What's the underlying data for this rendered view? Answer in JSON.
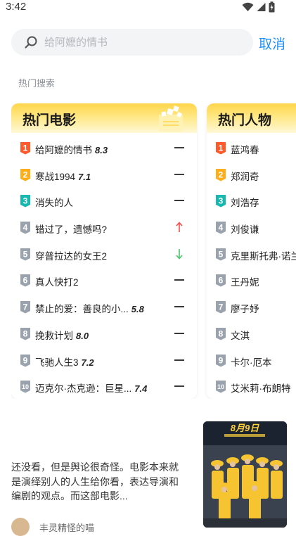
{
  "status": {
    "time": "3:42"
  },
  "search": {
    "placeholder": "给阿嬷的情书",
    "cancel_label": "取消"
  },
  "hot_search_label": "热门搜索",
  "colors": {
    "accent": "#1e8fff",
    "rank1": "#ff5a2c",
    "rank2": "#ffae1a",
    "rank3": "#17b8b0",
    "rank_other": "#9aa2ae",
    "up": "#ff4b4b",
    "down": "#4bc46a"
  },
  "movies_card": {
    "title": "热门电影",
    "items": [
      {
        "rank": "1",
        "title": "给阿嬷的情书",
        "score": "8.3",
        "trend": "flat"
      },
      {
        "rank": "2",
        "title": "寒战1994",
        "score": "7.1",
        "trend": "flat"
      },
      {
        "rank": "3",
        "title": "消失的人",
        "score": "",
        "trend": "flat"
      },
      {
        "rank": "4",
        "title": "错过了，遗憾吗?",
        "score": "",
        "trend": "up"
      },
      {
        "rank": "5",
        "title": "穿普拉达的女王2",
        "score": "",
        "trend": "down"
      },
      {
        "rank": "6",
        "title": "真人快打2",
        "score": "",
        "trend": "flat"
      },
      {
        "rank": "7",
        "title": "禁止的爱：善良的小...",
        "score": "5.8",
        "trend": "flat"
      },
      {
        "rank": "8",
        "title": "挽救计划",
        "score": "8.0",
        "trend": "flat"
      },
      {
        "rank": "9",
        "title": "飞驰人生3",
        "score": "7.2",
        "trend": "flat"
      },
      {
        "rank": "10",
        "title": "迈克尔·杰克逊：巨星...",
        "score": "7.4",
        "trend": "flat"
      }
    ]
  },
  "people_card": {
    "title": "热门人物",
    "items": [
      {
        "rank": "1",
        "name": "蓝鸿春"
      },
      {
        "rank": "2",
        "name": "郑润奇"
      },
      {
        "rank": "3",
        "name": "刘浩存"
      },
      {
        "rank": "4",
        "name": "刘俊谦"
      },
      {
        "rank": "5",
        "name": "克里斯托弗·诺兰"
      },
      {
        "rank": "6",
        "name": "王丹妮"
      },
      {
        "rank": "7",
        "name": "廖子妤"
      },
      {
        "rank": "8",
        "name": "文淇"
      },
      {
        "rank": "9",
        "name": "卡尔·厄本"
      },
      {
        "rank": "10",
        "name": "艾米莉·布朗特"
      }
    ]
  },
  "article": {
    "excerpt": "还没看，但是舆论很奇怪。电影本来就是演绎别人的人生给你看，表达导演和编剧的观点。而这部电影...",
    "author": "丰灵精怪的喵",
    "thumb_caption": "8月9日"
  }
}
